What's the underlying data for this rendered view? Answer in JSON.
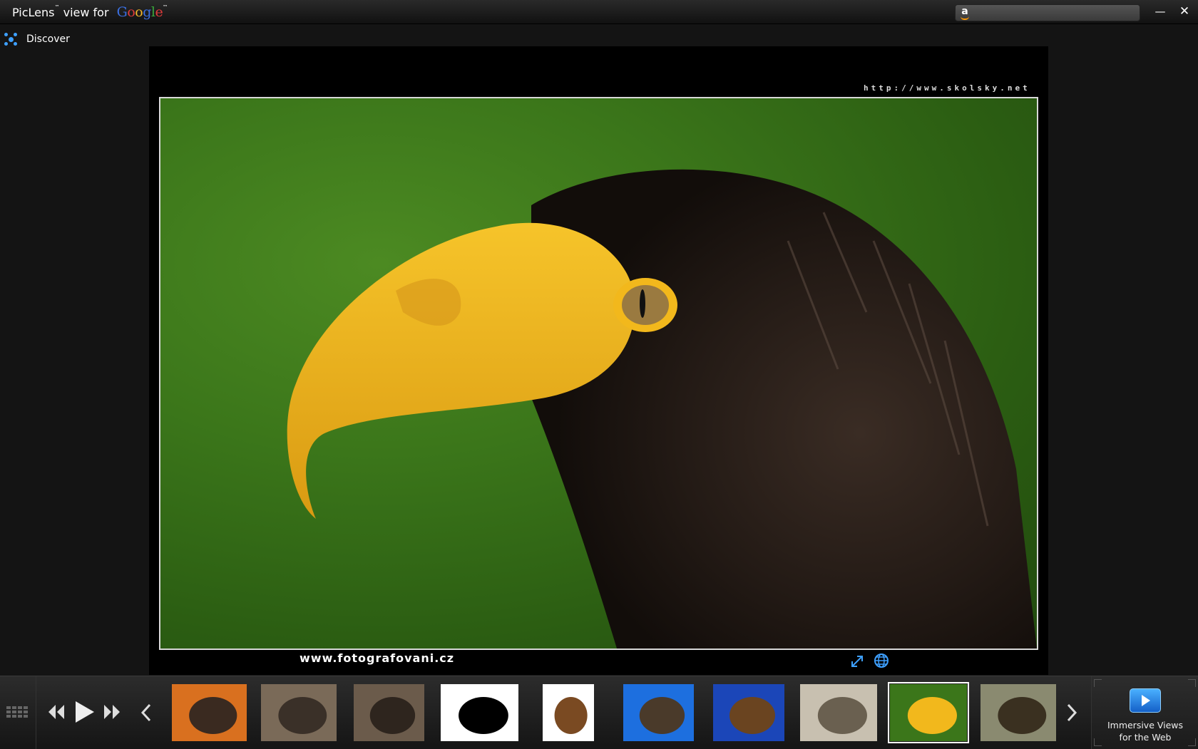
{
  "titlebar": {
    "brand_name": "PicLens",
    "brand_tm": "™",
    "view_for": "view for",
    "google_letters": [
      "G",
      "o",
      "o",
      "g",
      "l",
      "e"
    ],
    "google_tm": "™",
    "search_placeholder": "",
    "search_icon": "amazon-icon",
    "minimize_glyph": "—",
    "close_glyph": "✕"
  },
  "discover": {
    "label": "Discover",
    "icon": "discover-icon"
  },
  "stage": {
    "watermark": "http://www.skolsky.net",
    "caption": "www.fotografovani.cz",
    "photo_description_colors": {
      "background": "#3b761a",
      "beak": "#f2b81c",
      "feathers": "#2a201b"
    }
  },
  "bottombar": {
    "thumbnails": [
      {
        "name": "eagle-orange-bg",
        "bg": "#d9701f",
        "fg": "#3a2a20"
      },
      {
        "name": "bronze-eagle-brooch-1",
        "bg": "#7a6a58",
        "fg": "#3a3028"
      },
      {
        "name": "bronze-eagle-brooch-2",
        "bg": "#6b5b4b",
        "fg": "#2e251e"
      },
      {
        "name": "orel-logo",
        "bg": "#ffffff",
        "fg": "#000000"
      },
      {
        "name": "eagle-drawing",
        "bg": "#ffffff",
        "fg": "#7a4a22"
      },
      {
        "name": "eagle-blue-sky",
        "bg": "#1d6fdf",
        "fg": "#4a3a2a"
      },
      {
        "name": "golden-eagle-blue",
        "bg": "#1b46b8",
        "fg": "#6a4420"
      },
      {
        "name": "helicopter",
        "bg": "#c8c0b0",
        "fg": "#6a6050"
      },
      {
        "name": "steller-eagle-selected",
        "bg": "#3b761a",
        "fg": "#f2b81c"
      },
      {
        "name": "eagles-in-cage",
        "bg": "#8a8a70",
        "fg": "#3a3020"
      }
    ],
    "selected_index": 8,
    "promo": {
      "line1": "Immersive Views",
      "line2": "for the Web"
    }
  },
  "accent": "#3ea0ff"
}
